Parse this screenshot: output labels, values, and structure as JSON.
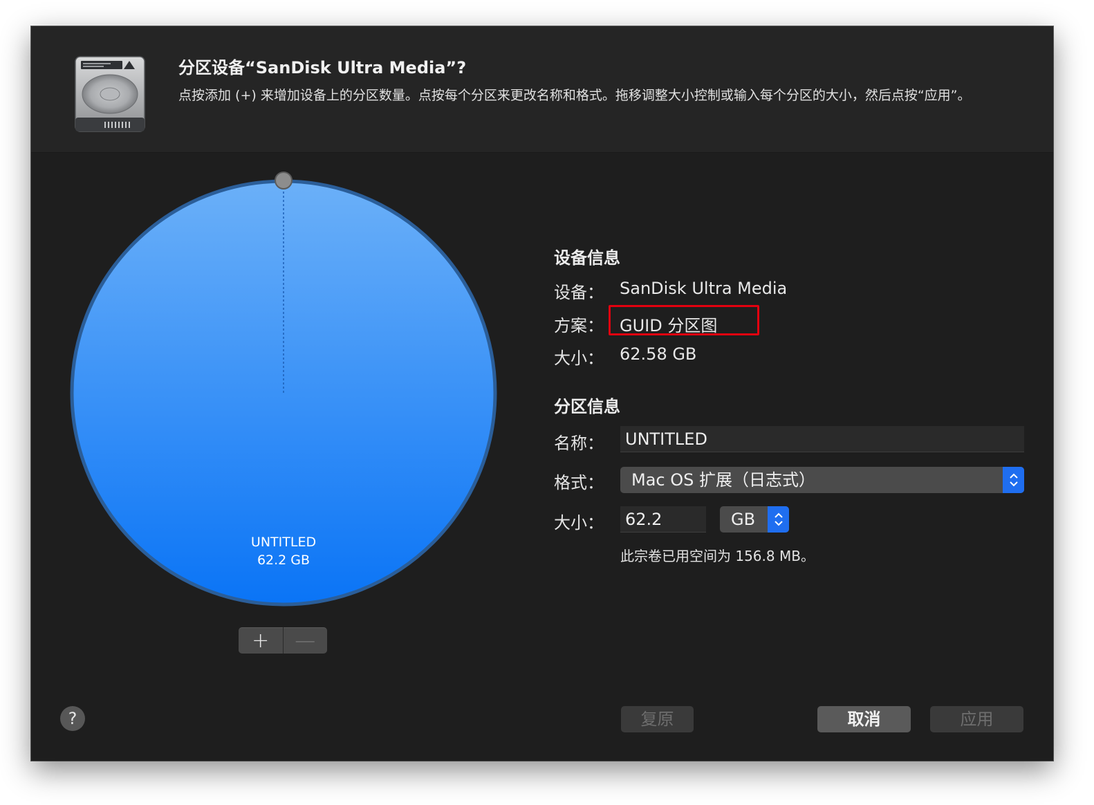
{
  "header": {
    "icon": "hard-drive-icon",
    "title": "分区设备“SanDisk Ultra Media”?",
    "description": "点按添加 (+) 来增加设备上的分区数量。点按每个分区来更改名称和格式。拖移调整大小控制或输入每个分区的大小，然后点按“应用”。"
  },
  "pie": {
    "partition_name": "UNTITLED",
    "partition_size": "62.2 GB",
    "fill_fraction": 1.0,
    "colors": {
      "top": "#6bb0f8",
      "bottom": "#0a74f6",
      "rim": "#2b5e99"
    }
  },
  "controls": {
    "add_label": "+",
    "remove_label": "—"
  },
  "device_info": {
    "section_title": "设备信息",
    "device_label": "设备：",
    "device_value": "SanDisk Ultra Media",
    "scheme_label": "方案：",
    "scheme_value": "GUID 分区图",
    "size_label": "大小：",
    "size_value": "62.58 GB",
    "highlight_color": "#e3000f"
  },
  "partition_info": {
    "section_title": "分区信息",
    "name_label": "名称：",
    "name_value": "UNTITLED",
    "format_label": "格式：",
    "format_value": "Mac OS 扩展（日志式）",
    "size_label": "大小：",
    "size_value": "62.2",
    "unit_value": "GB",
    "used_note": "此宗卷已用空间为 156.8 MB。"
  },
  "footer": {
    "help_label": "?",
    "revert_label": "复原",
    "cancel_label": "取消",
    "apply_label": "应用"
  },
  "accent": "#1f6ef0"
}
